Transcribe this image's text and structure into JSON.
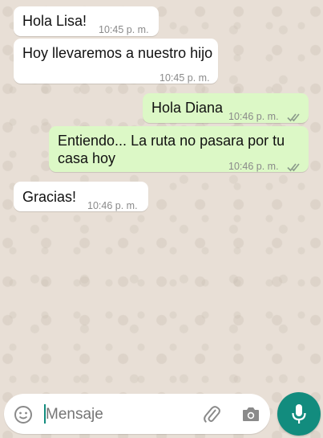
{
  "messages": [
    {
      "text": "Hola Lisa!",
      "time": "10:45 p. m.",
      "direction": "incoming"
    },
    {
      "text": "Hoy llevaremos a nuestro hijo",
      "time": "10:45 p. m.",
      "direction": "incoming"
    },
    {
      "text": "Hola Diana",
      "time": "10:46 p. m.",
      "direction": "outgoing",
      "status": "read-ticks"
    },
    {
      "line1": "Entiendo... La ruta no pasara por tu",
      "line2": "casa hoy",
      "time": "10:46 p. m.",
      "direction": "outgoing",
      "status": "read-ticks"
    },
    {
      "text": "Gracias!",
      "time": "10:46 p. m.",
      "direction": "incoming"
    }
  ],
  "composer": {
    "placeholder": "Mensaje"
  },
  "icons": {
    "emoji": "emoji-icon",
    "attach": "paperclip-icon",
    "camera": "camera-icon",
    "mic": "mic-icon"
  },
  "colors": {
    "incoming_bubble": "#ffffff",
    "outgoing_bubble": "#dcf8c6",
    "accent": "#128c7e",
    "wallpaper": "#e8dfd6"
  }
}
